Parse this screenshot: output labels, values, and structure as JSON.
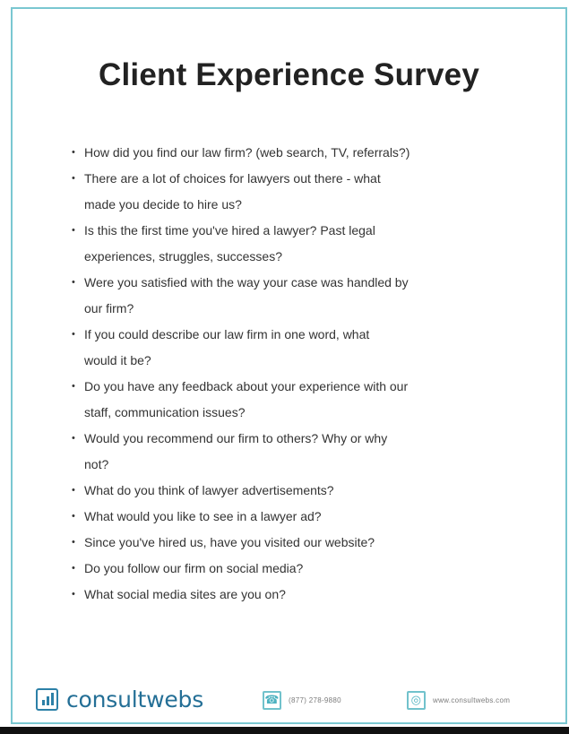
{
  "document": {
    "title": "Client Experience Survey",
    "questions": [
      {
        "bullet": "•",
        "lines": [
          "How did you find our law firm? (web search, TV, referrals?)"
        ]
      },
      {
        "bullet": "•",
        "lines": [
          "There are a lot of choices for lawyers out there - what",
          "made you decide to hire us?"
        ]
      },
      {
        "bullet": "•",
        "lines": [
          "Is this the first time you've hired a lawyer? Past legal",
          "experiences, struggles, successes?"
        ]
      },
      {
        "bullet": "•",
        "lines": [
          "Were you satisfied with the way your case was handled by",
          "our firm?"
        ]
      },
      {
        "bullet": "•",
        "lines": [
          "If you could describe our law firm in one word, what",
          "would it be?"
        ]
      },
      {
        "bullet": "•",
        "lines": [
          "Do you have any feedback about your experience with our",
          "staff, communication issues?"
        ]
      },
      {
        "bullet": "•",
        "lines": [
          "Would you recommend our firm to others? Why or why",
          "not?"
        ]
      },
      {
        "bullet": "•",
        "lines": [
          "What do you think of lawyer advertisements?"
        ]
      },
      {
        "bullet": "•",
        "lines": [
          "What would you like to see in a lawyer ad?"
        ]
      },
      {
        "bullet": "•",
        "lines": [
          "Since you've hired us, have you visited our website?"
        ]
      },
      {
        "bullet": "•",
        "lines": [
          "Do you follow our firm on social media?"
        ]
      },
      {
        "bullet": "•",
        "lines": [
          "What social media sites are you on?"
        ]
      }
    ]
  },
  "footer": {
    "brand": "consultwebs",
    "phone": "(877) 278-9880",
    "website": "www.consultwebs.com",
    "logo_icon": "bar-chart-icon",
    "phone_icon": "phone-icon",
    "website_icon": "globe-icon"
  },
  "colors": {
    "border_accent": "#7ac7d1",
    "brand_blue": "#246f96",
    "icon_teal": "#4cb2c0",
    "text_dark": "#222222"
  }
}
